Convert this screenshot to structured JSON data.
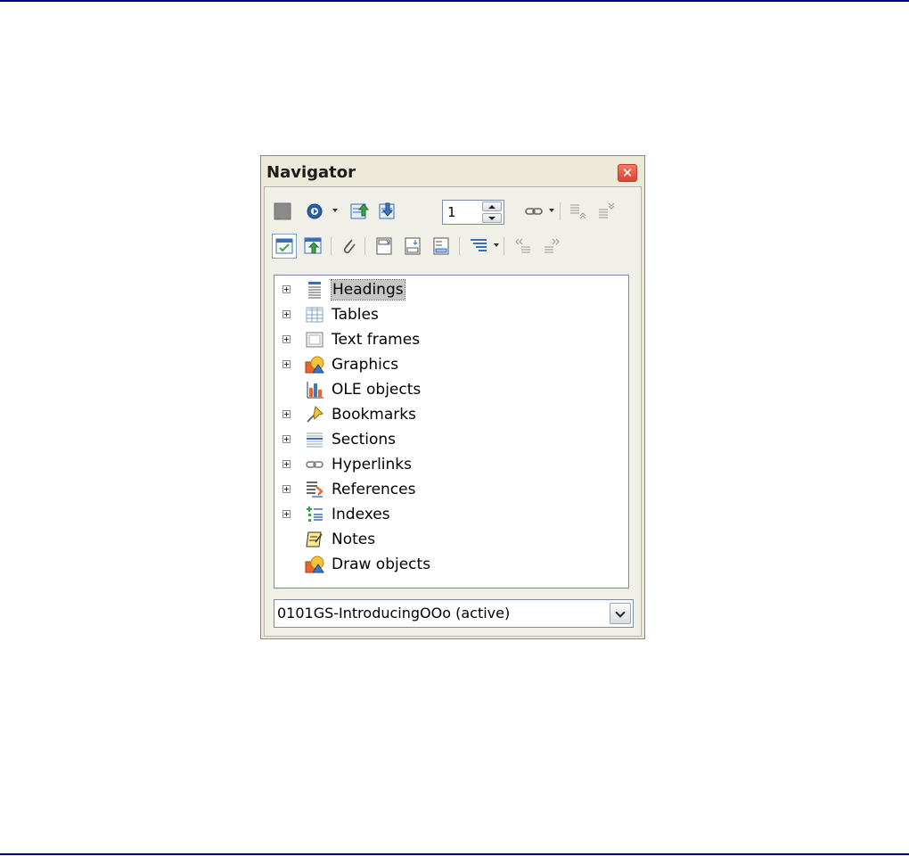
{
  "window": {
    "title": "Navigator",
    "close_icon": "close-icon",
    "close_color": "#d8442e"
  },
  "toolbar_row1": [
    {
      "name": "toggle-icon"
    },
    {
      "name": "navigation-icon",
      "has_dropdown": true
    },
    {
      "name": "previous-icon"
    },
    {
      "name": "next-icon"
    },
    {
      "name": "hyperlink-icon",
      "has_dropdown": true
    },
    {
      "name": "promote-level-icon"
    },
    {
      "name": "demote-level-icon"
    }
  ],
  "page_spinner": {
    "value": "1"
  },
  "toolbar_row2": [
    {
      "name": "list-box-icon",
      "active": true
    },
    {
      "name": "content-view-icon"
    },
    {
      "name": "reminder-icon"
    },
    {
      "name": "header-icon"
    },
    {
      "name": "footer-icon"
    },
    {
      "name": "anchor-icon"
    },
    {
      "name": "heading-levels-icon",
      "has_dropdown": true
    },
    {
      "name": "promote-chapter-icon"
    },
    {
      "name": "demote-chapter-icon"
    }
  ],
  "tree": {
    "items": [
      {
        "label": "Headings",
        "icon": "headings-icon",
        "expandable": true,
        "selected": true
      },
      {
        "label": "Tables",
        "icon": "tables-icon",
        "expandable": true
      },
      {
        "label": "Text frames",
        "icon": "text-frames-icon",
        "expandable": true
      },
      {
        "label": "Graphics",
        "icon": "graphics-icon",
        "expandable": true
      },
      {
        "label": "OLE objects",
        "icon": "ole-objects-icon",
        "expandable": false
      },
      {
        "label": "Bookmarks",
        "icon": "bookmarks-icon",
        "expandable": true
      },
      {
        "label": "Sections",
        "icon": "sections-icon",
        "expandable": true
      },
      {
        "label": "Hyperlinks",
        "icon": "hyperlinks-icon",
        "expandable": true
      },
      {
        "label": "References",
        "icon": "references-icon",
        "expandable": true
      },
      {
        "label": "Indexes",
        "icon": "indexes-icon",
        "expandable": true
      },
      {
        "label": "Notes",
        "icon": "notes-icon",
        "expandable": false
      },
      {
        "label": "Draw objects",
        "icon": "draw-objects-icon",
        "expandable": false
      }
    ]
  },
  "document_select": {
    "value": "0101GS-IntroducingOOo (active)"
  },
  "colors": {
    "page_rule": "#000080",
    "selection": "#c6c6c6",
    "dialog_bg": "#ece9d8"
  }
}
